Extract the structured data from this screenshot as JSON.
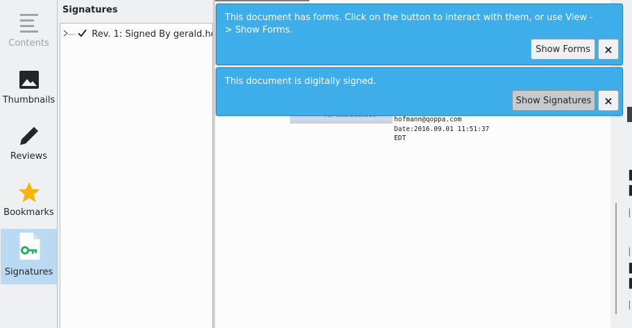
{
  "sidebar": {
    "items": [
      {
        "label": "Contents",
        "icon": "contents-icon",
        "state": "disabled"
      },
      {
        "label": "Thumbnails",
        "icon": "image-icon",
        "state": "normal"
      },
      {
        "label": "Reviews",
        "icon": "pencil-icon",
        "state": "normal"
      },
      {
        "label": "Bookmarks",
        "icon": "star-icon",
        "state": "normal"
      },
      {
        "label": "Signatures",
        "icon": "key-icon",
        "state": "active"
      }
    ]
  },
  "panel": {
    "title": "Signatures",
    "tree": [
      {
        "label": "Rev. 1: Signed By gerald.ho...",
        "checked": true,
        "collapsed": true
      }
    ]
  },
  "messages": {
    "forms": {
      "text": "This document has forms. Click on the button to interact with them, or use View -> Show Forms.",
      "button_label": "Show Forms",
      "close_label": "×"
    },
    "signed": {
      "text": "This document is digitally signed.",
      "button_label": "Show Signatures",
      "close_label": "×"
    }
  },
  "document": {
    "signature_lines": [
      "hofmann@qoppa.com",
      "Date:2016.09.01 11:51:37",
      "EDT"
    ],
    "signature_image_text": "PDF Tools & Libraries"
  },
  "colors": {
    "message_bg": "#3daee9",
    "active_sidebar": "#b9daf2",
    "star": "#f7b500",
    "key": "#27ae60"
  }
}
